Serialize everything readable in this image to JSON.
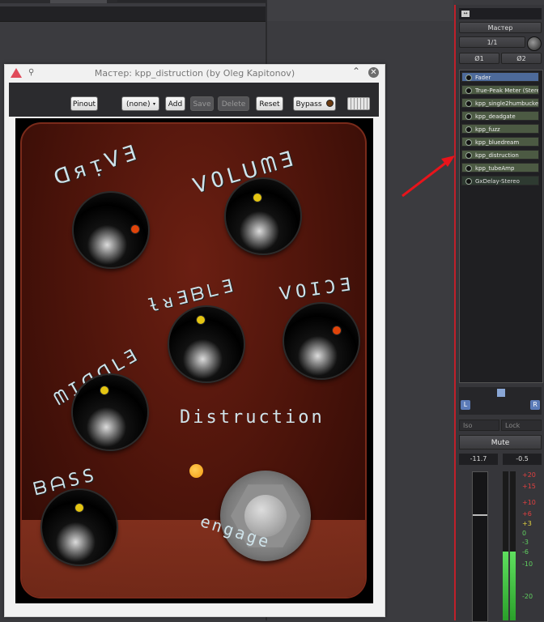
{
  "window": {
    "title": "Мастер: kpp_distruction (by Oleg Kapitonov)",
    "pin_icon": "pin-icon",
    "close_icon": "close-icon",
    "minimize_icon": "chevron-up-icon"
  },
  "toolbar": {
    "pinout": "Pinout",
    "preset": "(none)",
    "add": "Add",
    "save": "Save",
    "delete": "Delete",
    "reset": "Reset",
    "bypass": "Bypass"
  },
  "pedal": {
    "brand": "Distruction",
    "engage": "engage"
  },
  "mixer": {
    "name": "Мастер",
    "input": "1/1",
    "phase1": "Ø1",
    "phase2": "Ø2",
    "processors": [
      {
        "label": "Fader"
      },
      {
        "label": "True-Peak Meter (Stere"
      },
      {
        "label": "kpp_single2humbucke"
      },
      {
        "label": "kpp_deadgate"
      },
      {
        "label": "kpp_fuzz"
      },
      {
        "label": "kpp_bluedream"
      },
      {
        "label": "kpp_distruction"
      },
      {
        "label": "kpp_tubeAmp"
      },
      {
        "label": "GxDelay-Stereo"
      }
    ],
    "pan_l": "L",
    "pan_r": "R",
    "iso": "Iso",
    "lock": "Lock",
    "mute": "Mute",
    "gain_readout": "-11.7",
    "peak_readout": "-0.5",
    "scale": [
      "+20",
      "+15",
      "+10",
      "+6",
      "+3",
      "0",
      "-3",
      "-6",
      "-10",
      "-20"
    ]
  }
}
